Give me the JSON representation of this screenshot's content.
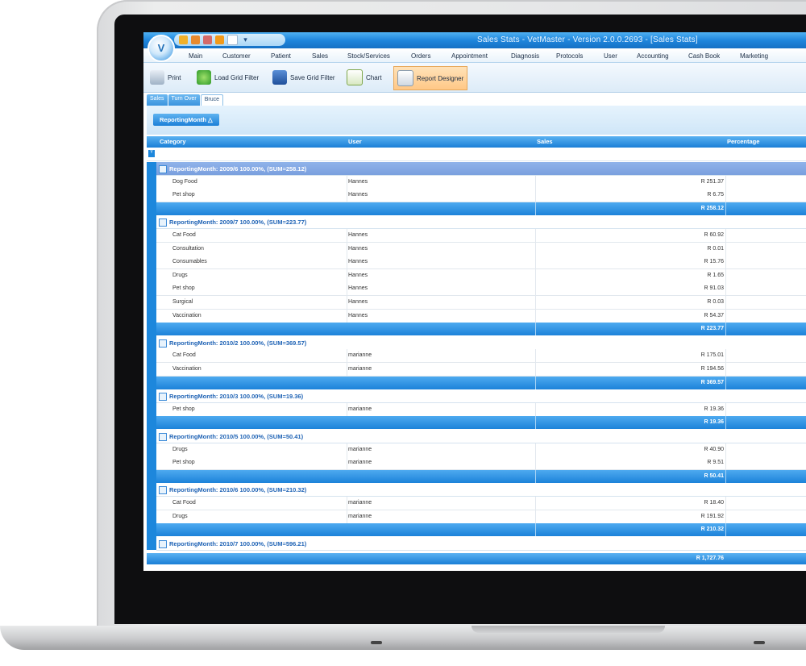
{
  "window": {
    "title": "Sales Stats - VetMaster - Version 2.0.0.2693 - [Sales Stats]",
    "logo_text": "V"
  },
  "menu": [
    "Main",
    "Customer",
    "Patient",
    "Sales",
    "Stock/Services",
    "Orders",
    "Appointment",
    "Diagnosis",
    "Protocols",
    "User",
    "Accounting",
    "Cash Book",
    "Marketing"
  ],
  "toolbar": {
    "print": "Print",
    "load_grid_filter": "Load Grid Filter",
    "save_grid_filter": "Save Grid Filter",
    "chart": "Chart",
    "report_designer": "Report Designer"
  },
  "tabs": [
    "Sales",
    "Turn Over",
    "Bruce"
  ],
  "group_button": "ReportingMonth △",
  "columns": {
    "category": "Category",
    "user": "User",
    "sales": "Sales",
    "percentage": "Percentage"
  },
  "groups": [
    {
      "header": "ReportingMonth: 2009/6 100.00%, (SUM=258.12)",
      "rows": [
        {
          "cat": "Dog Food",
          "user": "Hannes",
          "amt": "R 251.37"
        },
        {
          "cat": "Pet shop",
          "user": "Hannes",
          "amt": "R 6.75"
        }
      ],
      "sum": "R 258.12"
    },
    {
      "header": "ReportingMonth: 2009/7 100.00%, (SUM=223.77)",
      "rows": [
        {
          "cat": "Cat Food",
          "user": "Hannes",
          "amt": "R 60.92"
        },
        {
          "cat": "Consultation",
          "user": "Hannes",
          "amt": "R 0.01"
        },
        {
          "cat": "Consumables",
          "user": "Hannes",
          "amt": "R 15.76"
        },
        {
          "cat": "Drugs",
          "user": "Hannes",
          "amt": "R 1.65"
        },
        {
          "cat": "Pet shop",
          "user": "Hannes",
          "amt": "R 91.03"
        },
        {
          "cat": "Surgical",
          "user": "Hannes",
          "amt": "R 0.03"
        },
        {
          "cat": "Vaccination",
          "user": "Hannes",
          "amt": "R 54.37"
        }
      ],
      "sum": "R 223.77"
    },
    {
      "header": "ReportingMonth: 2010/2 100.00%, (SUM=369.57)",
      "rows": [
        {
          "cat": "Cat Food",
          "user": "marianne",
          "amt": "R 175.01"
        },
        {
          "cat": "Vaccination",
          "user": "marianne",
          "amt": "R 194.56"
        }
      ],
      "sum": "R 369.57"
    },
    {
      "header": "ReportingMonth: 2010/3 100.00%, (SUM=19.36)",
      "rows": [
        {
          "cat": "Pet shop",
          "user": "marianne",
          "amt": "R 19.36"
        }
      ],
      "sum": "R 19.36"
    },
    {
      "header": "ReportingMonth: 2010/5 100.00%, (SUM=50.41)",
      "rows": [
        {
          "cat": "Drugs",
          "user": "marianne",
          "amt": "R 40.90"
        },
        {
          "cat": "Pet shop",
          "user": "marianne",
          "amt": "R 9.51"
        }
      ],
      "sum": "R 50.41"
    },
    {
      "header": "ReportingMonth: 2010/6 100.00%, (SUM=210.32)",
      "rows": [
        {
          "cat": "Cat Food",
          "user": "marianne",
          "amt": "R 18.40"
        },
        {
          "cat": "Drugs",
          "user": "marianne",
          "amt": "R 191.92"
        }
      ],
      "sum": "R 210.32"
    },
    {
      "header": "ReportingMonth: 2010/7 100.00%, (SUM=596.21)",
      "rows": [],
      "sum": ""
    }
  ],
  "grand_total": "R 1,727.76"
}
